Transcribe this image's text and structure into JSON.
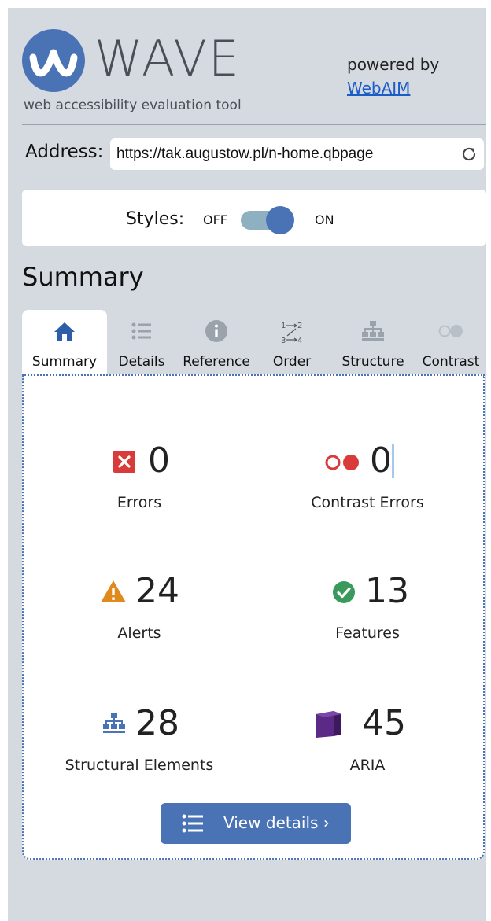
{
  "header": {
    "logo_text": "WAVE",
    "tagline": "web accessibility evaluation tool",
    "powered_by": "powered by",
    "webaim_link": "WebAIM"
  },
  "address": {
    "label": "Address:",
    "value": "https://tak.augustow.pl/n-home.qbpage",
    "reload_icon": "reload-icon"
  },
  "styles": {
    "label": "Styles:",
    "off": "OFF",
    "on": "ON",
    "state": "on"
  },
  "section_title": "Summary",
  "tabs": [
    {
      "label": "Summary",
      "icon": "home-icon",
      "active": true
    },
    {
      "label": "Details",
      "icon": "list-icon",
      "active": false
    },
    {
      "label": "Reference",
      "icon": "info-icon",
      "active": false
    },
    {
      "label": "Order",
      "icon": "order-icon",
      "active": false
    },
    {
      "label": "Structure",
      "icon": "structure-icon",
      "active": false
    },
    {
      "label": "Contrast",
      "icon": "contrast-icon",
      "active": false
    }
  ],
  "stats": {
    "errors": {
      "value": "0",
      "label": "Errors",
      "icon": "error-icon",
      "color": "#d93a3a"
    },
    "contrast": {
      "value": "0",
      "label": "Contrast Errors",
      "icon": "contrast-error-icon",
      "color": "#d93a3a"
    },
    "alerts": {
      "value": "24",
      "label": "Alerts",
      "icon": "alert-icon",
      "color": "#e08a1e"
    },
    "features": {
      "value": "13",
      "label": "Features",
      "icon": "feature-icon",
      "color": "#3a9a5b"
    },
    "structural": {
      "value": "28",
      "label": "Structural Elements",
      "icon": "structure-icon",
      "color": "#4a73b6"
    },
    "aria": {
      "value": "45",
      "label": "ARIA",
      "icon": "aria-icon",
      "color": "#5b2a86"
    }
  },
  "view_details": "View details ›",
  "colors": {
    "accent": "#4a73b6",
    "panel_bg": "#d5dae0"
  }
}
